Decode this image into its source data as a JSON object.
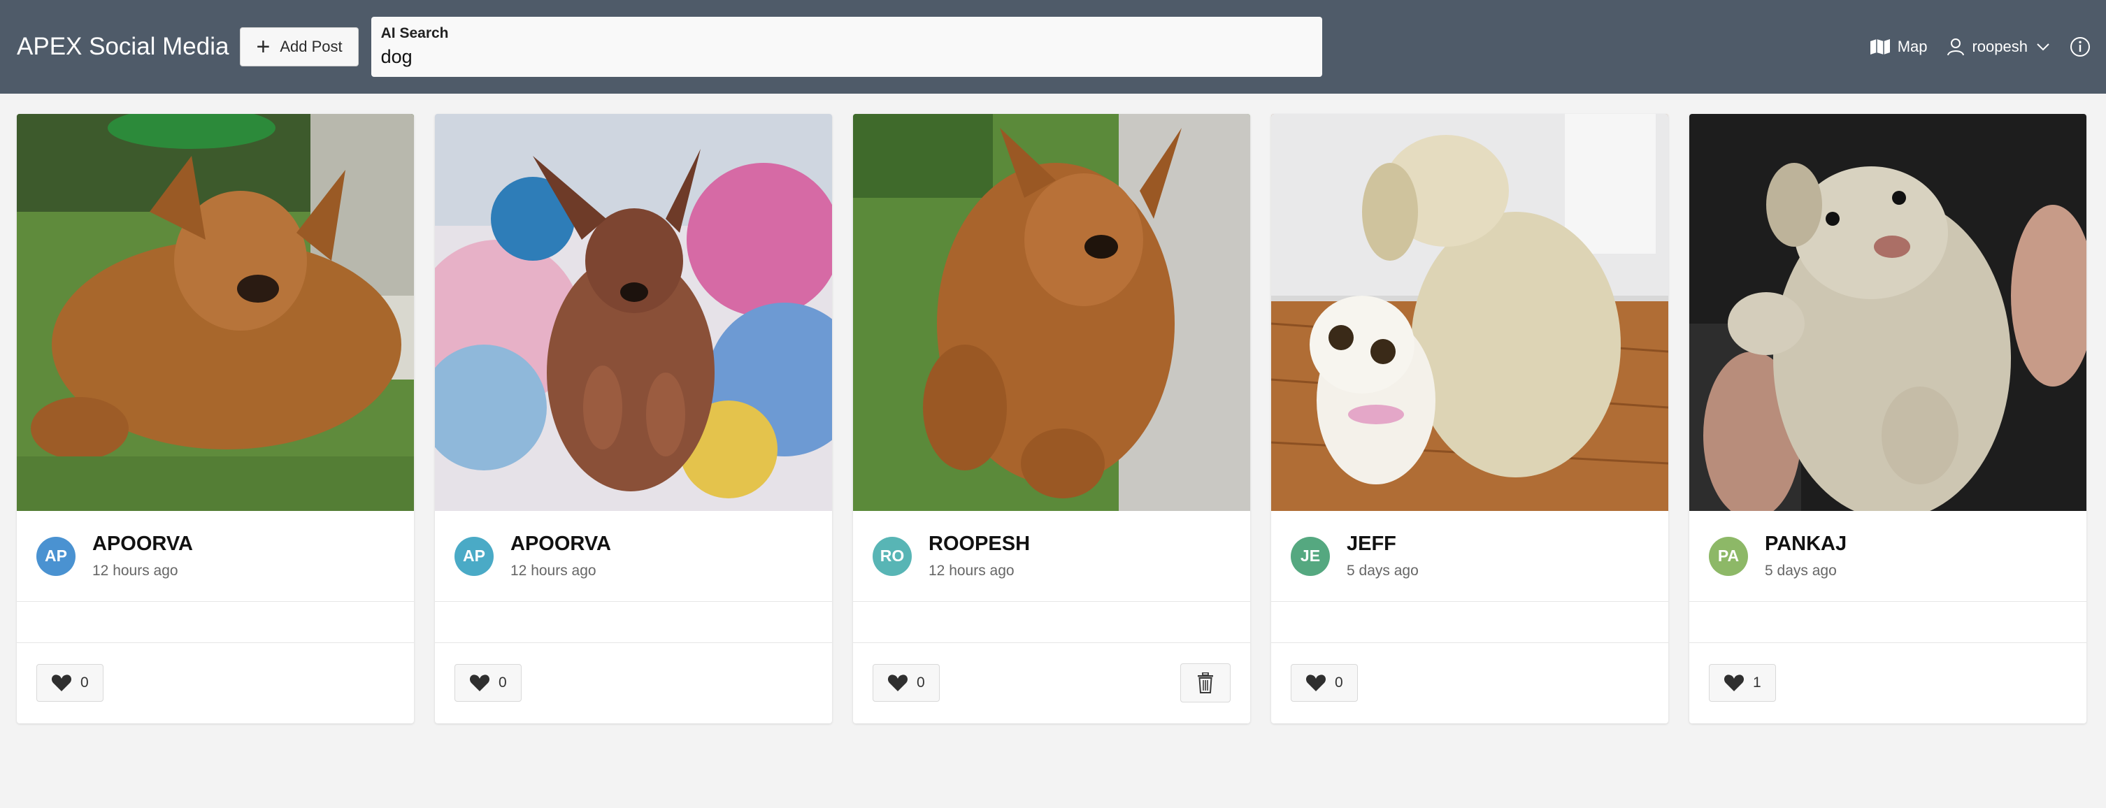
{
  "header": {
    "app_title": "APEX Social Media",
    "add_post_label": "Add Post",
    "search_label": "AI Search",
    "search_value": "dog",
    "map_label": "Map",
    "user_label": "roopesh"
  },
  "posts": [
    {
      "initials": "AP",
      "author": "APOORVA",
      "time": "12 hours ago",
      "likes": "0",
      "avatar_color": "#4a92d1",
      "photo": "dog-sunning-on-grass"
    },
    {
      "initials": "AP",
      "author": "APOORVA",
      "time": "12 hours ago",
      "likes": "0",
      "avatar_color": "#4aaac6",
      "photo": "dog-on-floral-pillow"
    },
    {
      "initials": "RO",
      "author": "ROOPESH",
      "time": "12 hours ago",
      "likes": "0",
      "avatar_color": "#58b5b5",
      "photo": "dog-lying-on-grass"
    },
    {
      "initials": "JE",
      "author": "JEFF",
      "time": "5 days ago",
      "likes": "0",
      "avatar_color": "#55a880",
      "photo": "plush-toy-dogs"
    },
    {
      "initials": "PA",
      "author": "PANKAJ",
      "time": "5 days ago",
      "likes": "1",
      "avatar_color": "#8db867",
      "photo": "puppy-held-in-hand"
    }
  ],
  "colors": {
    "header_bg": "#4f5b69",
    "page_bg": "#f3f3f3"
  }
}
